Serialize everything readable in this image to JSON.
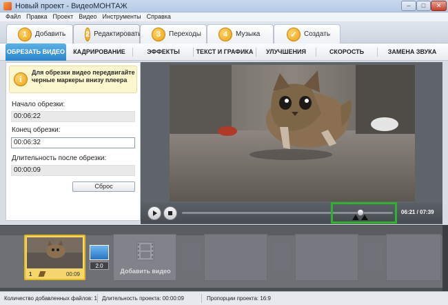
{
  "window": {
    "title": "Новый проект - ВидеоМОНТАЖ",
    "minimize": "–",
    "maximize": "□",
    "close": "✕"
  },
  "menu": [
    "Файл",
    "Правка",
    "Проект",
    "Видео",
    "Инструменты",
    "Справка"
  ],
  "steps": [
    {
      "num": "1",
      "label": "Добавить"
    },
    {
      "num": "2",
      "label": "Редактировать"
    },
    {
      "num": "3",
      "label": "Переходы"
    },
    {
      "num": "4",
      "label": "Музыка"
    },
    {
      "num": "✓",
      "label": "Создать"
    }
  ],
  "active_step": "Редактировать",
  "subtabs": [
    "ОБРЕЗАТЬ ВИДЕО",
    "КАДРИРОВАНИЕ",
    "ЭФФЕКТЫ",
    "ТЕКСТ И ГРАФИКА",
    "УЛУЧШЕНИЯ",
    "СКОРОСТЬ",
    "ЗАМЕНА ЗВУКА"
  ],
  "active_subtab": "ОБРЕЗАТЬ ВИДЕО",
  "trim_panel": {
    "hint_icon": "i",
    "hint": "Для обрезки видео передвигайте черные маркеры внизу плеера",
    "start_label": "Начало обрезки:",
    "start_value": "00:06:22",
    "end_label": "Конец обрезки:",
    "end_value": "00:06:32",
    "duration_label": "Длительность после обрезки:",
    "duration_value": "00:00:09",
    "reset_button": "Сброс"
  },
  "player": {
    "time": "06:21 / 07:39",
    "progress": 0.83,
    "play_icon": "play-icon",
    "stop_icon": "stop-icon"
  },
  "timeline": {
    "clip": {
      "number": "1",
      "duration": "00:09"
    },
    "transition_duration": "2.0",
    "add_video": "Добавить видео"
  },
  "status": {
    "files_count": "Количество добавленных файлов: 1",
    "project_duration": "Длительность проекта: 00:00:09",
    "aspect": "Пропорции проекта: 16:9"
  },
  "colors": {
    "accent_tab": "#2b86c9",
    "step_badge": "#f1a10e",
    "highlight": "#2db52a",
    "hint_bg": "#fdf7d0"
  }
}
